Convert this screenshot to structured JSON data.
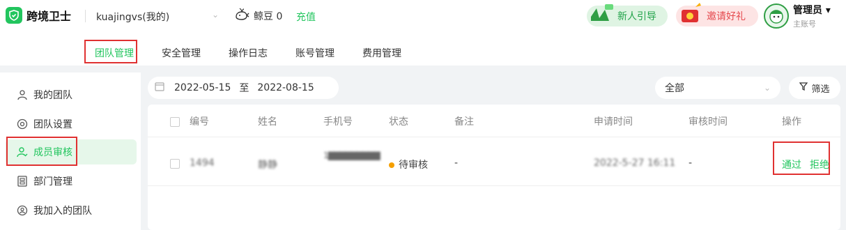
{
  "colors": {
    "accent": "#22c55e",
    "highlight": "#e03131",
    "pending": "#f59f00"
  },
  "header": {
    "logo_text": "跨境卫士",
    "logo_icon": "shield-icon",
    "account_label": "kuajingvs(我的)",
    "beans_label": "鲸豆 0",
    "recharge_label": "充值",
    "guide_label": "新人引导",
    "invite_label": "邀请好礼",
    "admin_name": "管理员",
    "admin_sub": "主账号"
  },
  "tabs": [
    {
      "label": "团队管理",
      "active": true
    },
    {
      "label": "安全管理"
    },
    {
      "label": "操作日志"
    },
    {
      "label": "账号管理"
    },
    {
      "label": "费用管理"
    }
  ],
  "sidebar": {
    "items": [
      {
        "label": "我的团队",
        "icon": "user-icon"
      },
      {
        "label": "团队设置",
        "icon": "settings-icon"
      },
      {
        "label": "成员审核",
        "icon": "user-check-icon",
        "active": true
      },
      {
        "label": "部门管理",
        "icon": "department-icon"
      },
      {
        "label": "我加入的团队",
        "icon": "joined-team-icon"
      }
    ]
  },
  "filters": {
    "date_start": "2022-05-15",
    "date_sep": "至",
    "date_end": "2022-08-15",
    "status_select": "全部",
    "filter_label": "筛选"
  },
  "table": {
    "columns": [
      "编号",
      "姓名",
      "手机号",
      "状态",
      "备注",
      "申请时间",
      "审核时间",
      "操作"
    ],
    "rows": [
      {
        "id": "1494",
        "name": "静静",
        "phone": "1▇▇▇▇▇▇▇▇▇",
        "status": "待审核",
        "note": "-",
        "apply_time": "2022-5-27 16:11",
        "review_time": "-",
        "approve": "通过",
        "reject": "拒绝"
      }
    ]
  }
}
